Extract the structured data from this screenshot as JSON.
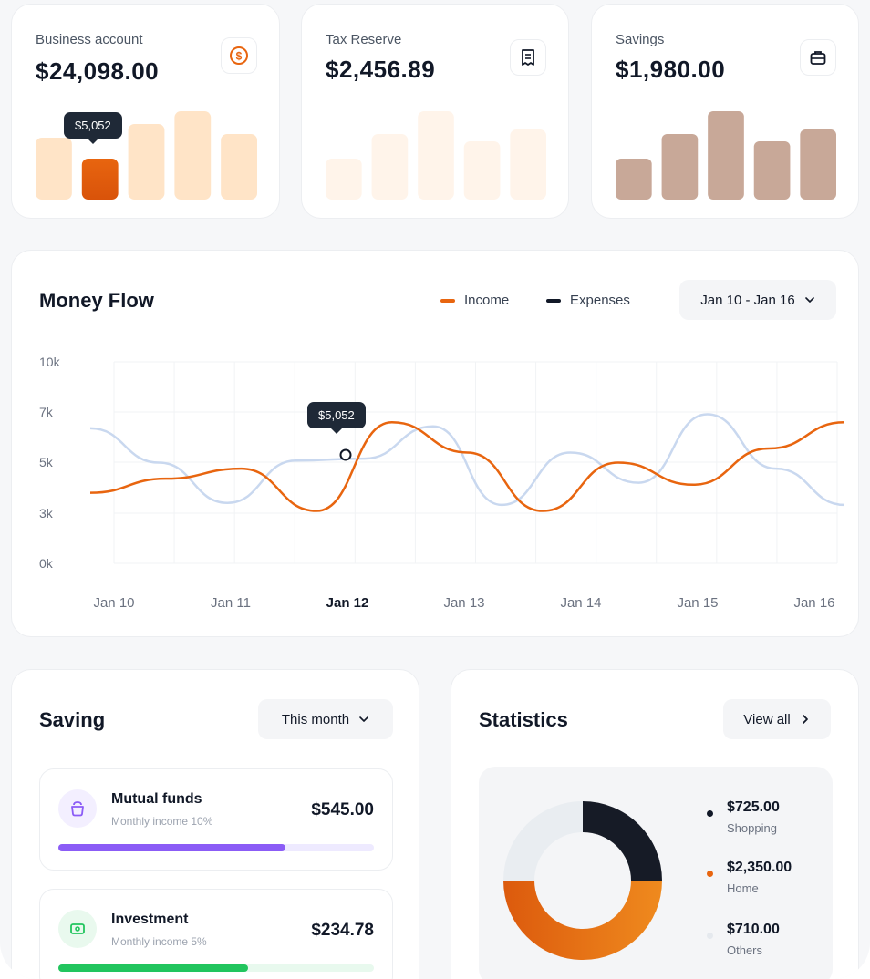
{
  "accounts": [
    {
      "label": "Business account",
      "value": "$24,098.00",
      "icon": "dollar-coin-icon",
      "tooltip": "$5,052"
    },
    {
      "label": "Tax Reserve",
      "value": "$2,456.89",
      "icon": "receipt-icon"
    },
    {
      "label": "Savings",
      "value": "$1,980.00",
      "icon": "briefcase-icon"
    }
  ],
  "money_flow": {
    "title": "Money Flow",
    "legend": {
      "income": "Income",
      "expenses": "Expenses"
    },
    "range_label": "Jan 10 - Jan 16",
    "tooltip": "$5,052",
    "y_ticks": [
      "10k",
      "7k",
      "5k",
      "3k",
      "0k"
    ],
    "x_ticks": [
      "Jan 10",
      "Jan 11",
      "Jan 12",
      "Jan 13",
      "Jan 14",
      "Jan 15",
      "Jan 16"
    ],
    "active_x": "Jan 12"
  },
  "chart_data": {
    "type": "line",
    "x": [
      "Jan 10",
      "Jan 11",
      "Jan 12",
      "Jan 13",
      "Jan 14",
      "Jan 15",
      "Jan 16"
    ],
    "series": [
      {
        "name": "Income",
        "color": "#e8650f",
        "values": [
          3500,
          4200,
          4700,
          2600,
          7000,
          5500,
          2600,
          5000,
          3900,
          5700,
          7000
        ]
      },
      {
        "name": "Expenses",
        "color": "#c9d8ef",
        "values": [
          6700,
          5000,
          3000,
          5100,
          5200,
          6800,
          2900,
          5500,
          4000,
          7400,
          4700,
          2900
        ]
      }
    ],
    "ylim": [
      0,
      10000
    ]
  },
  "saving": {
    "title": "Saving",
    "period": "This month",
    "items": [
      {
        "name": "Mutual funds",
        "sub": "Monthly income 10%",
        "amount": "$545.00",
        "progress": 0.72,
        "color": "#8b5cf6"
      },
      {
        "name": "Investment",
        "sub": "Monthly income 5%",
        "amount": "$234.78",
        "progress": 0.6,
        "color": "#22c55e"
      }
    ]
  },
  "statistics": {
    "title": "Statistics",
    "view_all": "View all",
    "items": [
      {
        "value": "$725.00",
        "label": "Shopping",
        "color": "#111827"
      },
      {
        "value": "$2,350.00",
        "label": "Home",
        "color": "#e8650f"
      },
      {
        "value": "$710.00",
        "label": "Others",
        "color": "#e5e9ee"
      }
    ]
  }
}
